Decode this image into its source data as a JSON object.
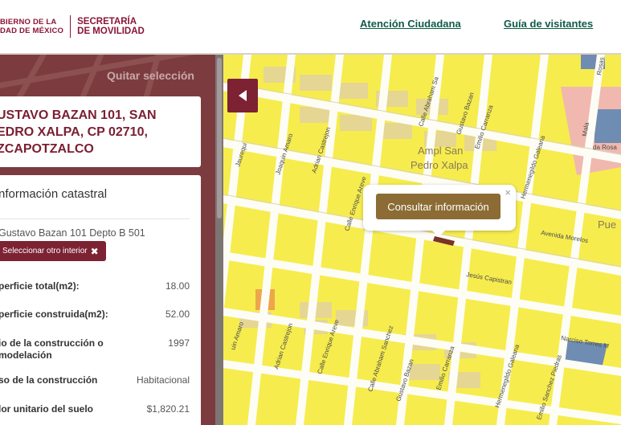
{
  "header": {
    "logo_gobierno_line1": "BIERNO DE LA",
    "logo_gobierno_line2": "DAD DE MÉXICO",
    "logo_secretaria_line1": "SECRETARÍA",
    "logo_secretaria_line2": "DE MOVILIDAD",
    "nav": [
      {
        "label": "Atención Ciudadana"
      },
      {
        "label": "Guía de visitantes"
      }
    ]
  },
  "sidebar": {
    "clear_selection": "Quitar selección",
    "address": "USTAVO BAZAN 101, SAN\nEDRO XALPA, CP 02710,\nZCAPOTZALCO",
    "info": {
      "title": "nformación catastral",
      "interior": "Gustavo Bazan 101 Depto B 501",
      "select_other": "Seleccionar otro interior",
      "select_other_icon": "✖",
      "rows": [
        {
          "label": "perficie total(m2):",
          "value": "18.00"
        },
        {
          "label": "perficie construida(m2):",
          "value": "52.00"
        },
        {
          "label": "io de la construcción o\nmodelación",
          "value": "1997"
        },
        {
          "label": "so de la construcción",
          "value": "Habitacional"
        },
        {
          "label": "lor unitario del suelo",
          "value": "$1,820.21"
        }
      ]
    }
  },
  "map": {
    "popup_button": "Consultar información",
    "popup_close": "×",
    "labels": {
      "colonia_1": "Ampl San",
      "colonia_2": "Pedro Xalpa",
      "avenida_morelos": "Avenida Morelos",
      "jesus_capistran": "Jesús Capistran",
      "narciso_torres": "Narciso Torres M",
      "hermenegildo_1": "Hermenegildo Galeana",
      "hermenegildo_2": "Hermenegildo Galeana",
      "emilio_carranza_1": "Emilio Carranza",
      "emilio_carranza_2": "Emilio Carranza",
      "gustavo_bazan_1": "Gustavo Bazan",
      "gustavo_bazan_2": "Gustavo Bazan",
      "abraham_1": "Calle Abraham Sa",
      "abraham_2": "Calle Abraham Sanchez",
      "enrique_1": "Calle Enrique Areve",
      "enrique_2": "Calle Enrique Areve",
      "adrian_1": "Adrian Castrejon",
      "adrian_2": "Adrian Castrejon",
      "joaquin": "Joaquin Amaro",
      "jaurequi": "Jaurequi",
      "juan_amaro": "uin Amaro",
      "emilio_sanchez": "Emilio Sanchez Piedras",
      "rosas": "Rosas",
      "rosa": "da Rosa",
      "pue": "Pue",
      "mala": "Mala"
    },
    "colors": {
      "block": "#f6ec4e",
      "street": "#fdfdf6",
      "building": "#e5d694",
      "selected_parcel": "#7a3326",
      "orange_parcel": "#eda64a",
      "blue_area": "#6f8cb2",
      "pink_area": "#f0b8ae"
    }
  }
}
